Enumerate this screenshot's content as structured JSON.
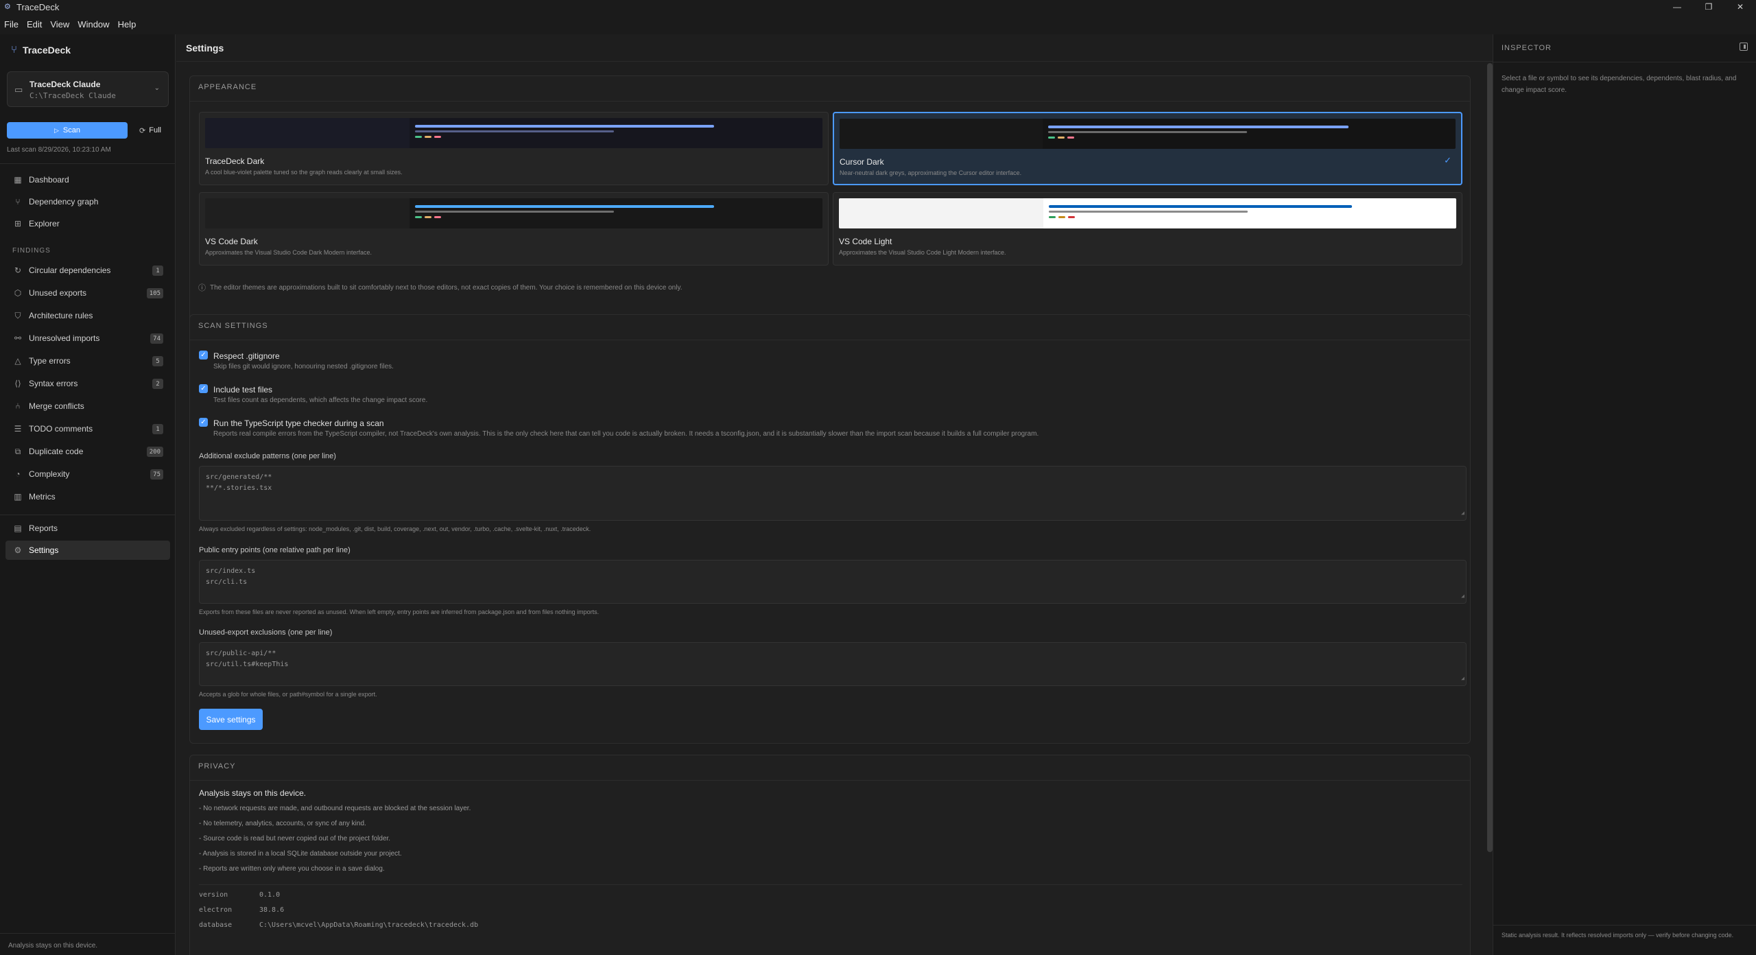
{
  "window": {
    "title": "TraceDeck",
    "icon": "gear-icon",
    "controls": [
      "minimize-icon",
      "restore-icon",
      "close-icon"
    ]
  },
  "menubar": {
    "items": [
      "File",
      "Edit",
      "View",
      "Window",
      "Help"
    ]
  },
  "sidebar": {
    "brand": "TraceDeck",
    "project": {
      "name": "TraceDeck Claude",
      "path": "C:\\TraceDeck Claude"
    },
    "scan_label": "Scan",
    "full_label": "Full",
    "last_scan": "Last scan 8/29/2026, 10:23:10 AM",
    "nav_top": [
      {
        "label": "Dashboard",
        "icon": "grid-icon"
      },
      {
        "label": "Dependency graph",
        "icon": "graph-icon"
      },
      {
        "label": "Explorer",
        "icon": "tree-icon"
      }
    ],
    "findings_label": "FINDINGS",
    "findings": [
      {
        "label": "Circular dependencies",
        "badge": "1",
        "icon": "cycle-icon"
      },
      {
        "label": "Unused exports",
        "badge": "105",
        "icon": "package-icon"
      },
      {
        "label": "Architecture rules",
        "badge": "",
        "icon": "shield-icon"
      },
      {
        "label": "Unresolved imports",
        "badge": "74",
        "icon": "broken-link-icon"
      },
      {
        "label": "Type errors",
        "badge": "5",
        "icon": "warning-icon"
      },
      {
        "label": "Syntax errors",
        "badge": "2",
        "icon": "code-icon"
      },
      {
        "label": "Merge conflicts",
        "badge": "",
        "icon": "merge-icon"
      },
      {
        "label": "TODO comments",
        "badge": "1",
        "icon": "list-icon"
      },
      {
        "label": "Duplicate code",
        "badge": "200",
        "icon": "copy-icon"
      },
      {
        "label": "Complexity",
        "badge": "75",
        "icon": "gauge-icon"
      },
      {
        "label": "Metrics",
        "badge": "",
        "icon": "bar-chart-icon"
      }
    ],
    "nav_bottom": [
      {
        "label": "Reports",
        "icon": "document-icon"
      },
      {
        "label": "Settings",
        "icon": "gear-icon"
      }
    ],
    "footer": "Analysis stays on this device."
  },
  "main": {
    "title": "Settings",
    "appearance": {
      "title": "APPEARANCE",
      "themes": [
        {
          "name": "TraceDeck Dark",
          "desc": "A cool blue-violet palette tuned so the graph reads clearly at small sizes.",
          "selected": false,
          "colors": {
            "left": "#1a1b26",
            "right": "#16161e",
            "blue": "#7aa2f7",
            "gray": "#565f89"
          }
        },
        {
          "name": "Cursor Dark",
          "desc": "Near-neutral dark greys, approximating the Cursor editor interface.",
          "selected": true,
          "colors": {
            "left": "#181818",
            "right": "#141414",
            "blue": "#7aa2f7",
            "gray": "#6b6b6b"
          }
        },
        {
          "name": "VS Code Dark",
          "desc": "Approximates the Visual Studio Code Dark Modern interface.",
          "selected": false,
          "colors": {
            "left": "#1f1f1f",
            "right": "#181818",
            "blue": "#4daafc",
            "gray": "#6e6e6e"
          }
        },
        {
          "name": "VS Code Light",
          "desc": "Approximates the Visual Studio Code Light Modern interface.",
          "selected": false,
          "colors": {
            "left": "#f3f3f3",
            "right": "#ffffff",
            "blue": "#005fb8",
            "gray": "#8a8a8a"
          }
        }
      ],
      "note": "The editor themes are approximations built to sit comfortably next to those editors, not exact copies of them. Your choice is remembered on this device only."
    },
    "scan": {
      "title": "SCAN SETTINGS",
      "options": [
        {
          "label": "Respect .gitignore",
          "desc": "Skip files git would ignore, honouring nested .gitignore files.",
          "checked": true
        },
        {
          "label": "Include test files",
          "desc": "Test files count as dependents, which affects the change impact score.",
          "checked": true
        },
        {
          "label": "Run the TypeScript type checker during a scan",
          "desc": "Reports real compile errors from the TypeScript compiler, not TraceDeck's own analysis. This is the only check here that can tell you code is actually broken. It needs a tsconfig.json, and it is substantially slower than the import scan because it builds a full compiler program.",
          "checked": true
        }
      ],
      "exclude": {
        "label": "Additional exclude patterns (one per line)",
        "lines": [
          "src/generated/**",
          "**/*.stories.tsx"
        ],
        "hint": "Always excluded regardless of settings: node_modules, .git, dist, build, coverage, .next, out, vendor, .turbo, .cache, .svelte-kit, .nuxt, .tracedeck."
      },
      "entry": {
        "label": "Public entry points (one relative path per line)",
        "lines": [
          "src/index.ts",
          "src/cli.ts"
        ],
        "hint": "Exports from these files are never reported as unused. When left empty, entry points are inferred from package.json and from files nothing imports."
      },
      "unused": {
        "label": "Unused-export exclusions (one per line)",
        "lines": [
          "src/public-api/**",
          "src/util.ts#keepThis"
        ],
        "hint": "Accepts a glob for whole files, or path#symbol for a single export."
      },
      "save_label": "Save settings"
    },
    "privacy": {
      "title": "PRIVACY",
      "heading": "Analysis stays on this device.",
      "items": [
        "- No network requests are made, and outbound requests are blocked at the session layer.",
        "- No telemetry, analytics, accounts, or sync of any kind.",
        "- Source code is read but never copied out of the project folder.",
        "- Analysis is stored in a local SQLite database outside your project.",
        "- Reports are written only where you choose in a save dialog."
      ],
      "info": [
        {
          "key": "version",
          "value": "0.1.0"
        },
        {
          "key": "electron",
          "value": "38.8.6"
        },
        {
          "key": "database",
          "value": "C:\\Users\\mcvel\\AppData\\Roaming\\tracedeck\\tracedeck.db"
        }
      ]
    }
  },
  "inspector": {
    "title": "INSPECTOR",
    "empty_text": "Select a file or symbol to see its dependencies, dependents, blast radius, and change impact score.",
    "footer": "Static analysis result. It reflects resolved imports only — verify before changing code."
  },
  "accent": "#4c9aff"
}
